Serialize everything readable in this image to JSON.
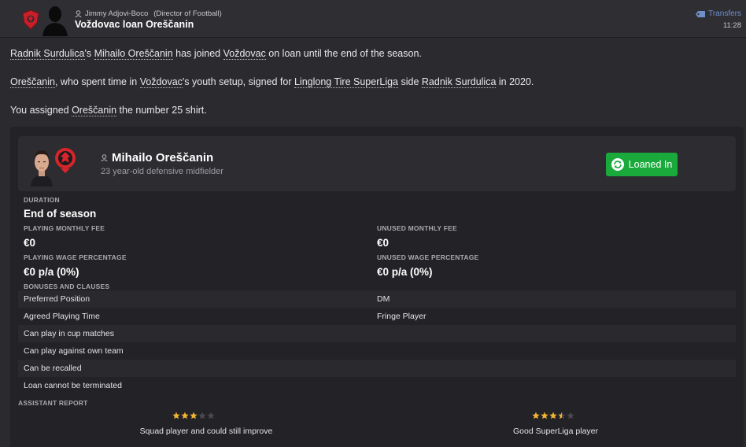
{
  "header": {
    "sender_name": "Jimmy Adjovi-Boco",
    "sender_role": "(Director of Football)",
    "subject": "Voždovac loan Oreščanin",
    "category": "Transfers",
    "time": "11:28"
  },
  "body": {
    "p1": {
      "a": "Radnik Surdulica",
      "b": "'s ",
      "c": "Mihailo Oreščanin",
      "d": " has joined ",
      "e": "Voždovac",
      "f": " on loan until the end of the season."
    },
    "p2": {
      "a": "Oreščanin",
      "b": ", who spent time in ",
      "c": "Voždovac",
      "d": "'s youth setup, signed for ",
      "e": "Linglong Tire SuperLiga",
      "f": " side ",
      "g": "Radnik Surdulica",
      "h": " in 2020."
    },
    "p3": {
      "a": "You assigned ",
      "b": "Oreščanin",
      "c": " the number 25 shirt."
    }
  },
  "player": {
    "name": "Mihailo Oreščanin",
    "description": "23 year-old defensive midfielder",
    "status": "Loaned In"
  },
  "details": {
    "duration_label": "DURATION",
    "duration_value": "End of season",
    "playing_fee_label": "PLAYING MONTHLY FEE",
    "playing_fee_value": "€0",
    "unused_fee_label": "UNUSED MONTHLY FEE",
    "unused_fee_value": "€0",
    "playing_wage_label": "PLAYING WAGE PERCENTAGE",
    "playing_wage_value": "€0 p/a (0%)",
    "unused_wage_label": "UNUSED WAGE PERCENTAGE",
    "unused_wage_value": "€0 p/a (0%)",
    "bonuses_label": "BONUSES AND CLAUSES"
  },
  "clauses": [
    {
      "name": "Preferred Position",
      "value": "DM"
    },
    {
      "name": "Agreed Playing Time",
      "value": "Fringe Player"
    },
    {
      "name": "Can play in cup matches",
      "value": ""
    },
    {
      "name": "Can play against own team",
      "value": ""
    },
    {
      "name": "Can be recalled",
      "value": ""
    },
    {
      "name": "Loan cannot be terminated",
      "value": ""
    }
  ],
  "assistant_report": {
    "label": "ASSISTANT REPORT",
    "current_ability": {
      "stars": 3,
      "max": 5,
      "text": "Squad player and could still improve"
    },
    "potential_ability": {
      "stars": 3.5,
      "max": 5,
      "text": "Good SuperLiga player"
    }
  },
  "colors": {
    "accent_green": "#1aaa3c",
    "star_gold": "#f2b530",
    "star_empty": "#4a494f",
    "category_blue": "#6f8fc9",
    "club_red": "#d8242b"
  }
}
